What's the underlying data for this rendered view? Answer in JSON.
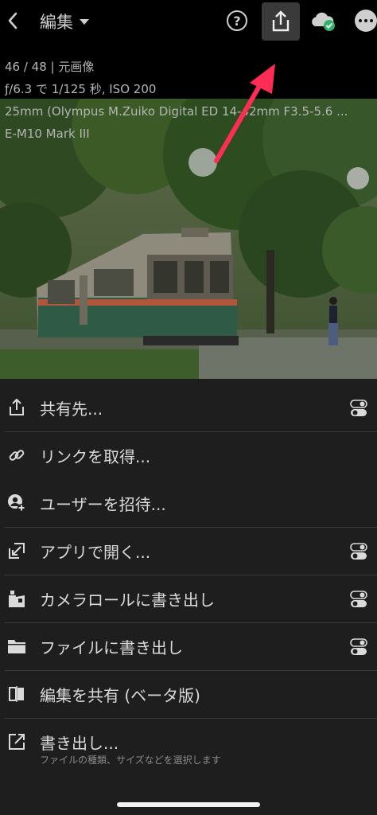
{
  "header": {
    "title": "編集",
    "help_glyph": "?"
  },
  "photo_info": {
    "line1": "46 / 48 | 元画像",
    "line2": "ƒ/6.3 で 1/125 秒, ISO 200",
    "line3": "25mm (Olympus M.Zuiko Digital ED 14-42mm F3.5-5.6 ...",
    "line4": "E-M10 Mark III"
  },
  "annotation": {
    "color": "#ff2d55"
  },
  "menu": {
    "items": [
      {
        "label": "共有先...",
        "icon": "share-icon",
        "has_toggle": true
      },
      {
        "label": "リンクを取得...",
        "icon": "link-icon",
        "has_toggle": false
      },
      {
        "label": "ユーザーを招待...",
        "icon": "invite-user-icon",
        "has_toggle": false
      },
      {
        "label": "アプリで開く...",
        "icon": "open-in-app-icon",
        "has_toggle": true
      },
      {
        "label": "カメラロールに書き出し",
        "icon": "camera-roll-icon",
        "has_toggle": true
      },
      {
        "label": "ファイルに書き出し",
        "icon": "folder-icon",
        "has_toggle": true
      },
      {
        "label": "編集を共有 (ベータ版)",
        "icon": "share-edits-icon",
        "has_toggle": false
      },
      {
        "label": "書き出し...",
        "sublabel": "ファイルの種類、サイズなどを選択します",
        "icon": "export-icon",
        "has_toggle": false
      }
    ]
  },
  "colors": {
    "background": "#000000",
    "sheet": "#1e1e1e",
    "text": "#dadada",
    "subtext": "#8a8a8a",
    "cloud_check": "#2fb36a"
  }
}
